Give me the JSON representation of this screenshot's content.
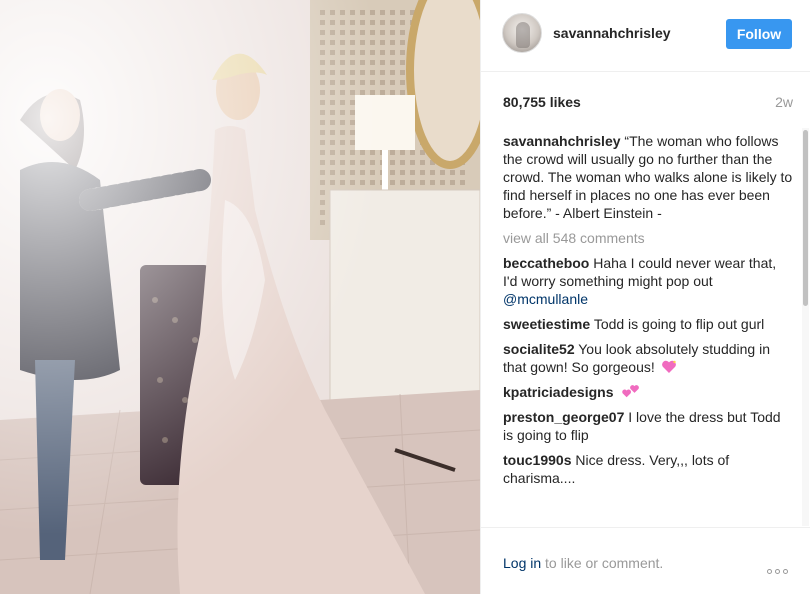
{
  "post": {
    "photo_alt": "",
    "header": {
      "username": "savannahchrisley",
      "follow_label": "Follow"
    },
    "likes": "80,755 likes",
    "time_ago": "2w",
    "caption": {
      "username": "savannahchrisley",
      "text": "“The woman who follows the crowd will usually go no further than the crowd. The woman who walks alone is likely to find herself in places no one has ever been before.” - Albert Einstein -"
    },
    "view_all": "view all 548 comments",
    "comments": [
      {
        "username": "beccatheboo",
        "text": "Haha I could never wear that, I'd worry something might pop out",
        "mention": "@mcmullanle"
      },
      {
        "username": "sweetiestime",
        "text": "Todd is going to flip out gurl"
      },
      {
        "username": "socialite52",
        "text": "You look absolutely studding in that gown! So gorgeous!",
        "emoji": "sparkling-heart-icon"
      },
      {
        "username": "kpatriciadesigns",
        "text": "",
        "emoji": "two-hearts-icon"
      },
      {
        "username": "preston_george07",
        "text": "I love the dress but Todd is going to flip"
      },
      {
        "username": "touc1990s",
        "text": "Nice dress. Very,,, lots of charisma...."
      }
    ],
    "footer": {
      "login_link": "Log in",
      "login_rest": " to like or comment."
    },
    "colors": {
      "follow_button": "#3897f0",
      "link": "#003569",
      "muted": "#999999",
      "text": "#262626"
    }
  }
}
